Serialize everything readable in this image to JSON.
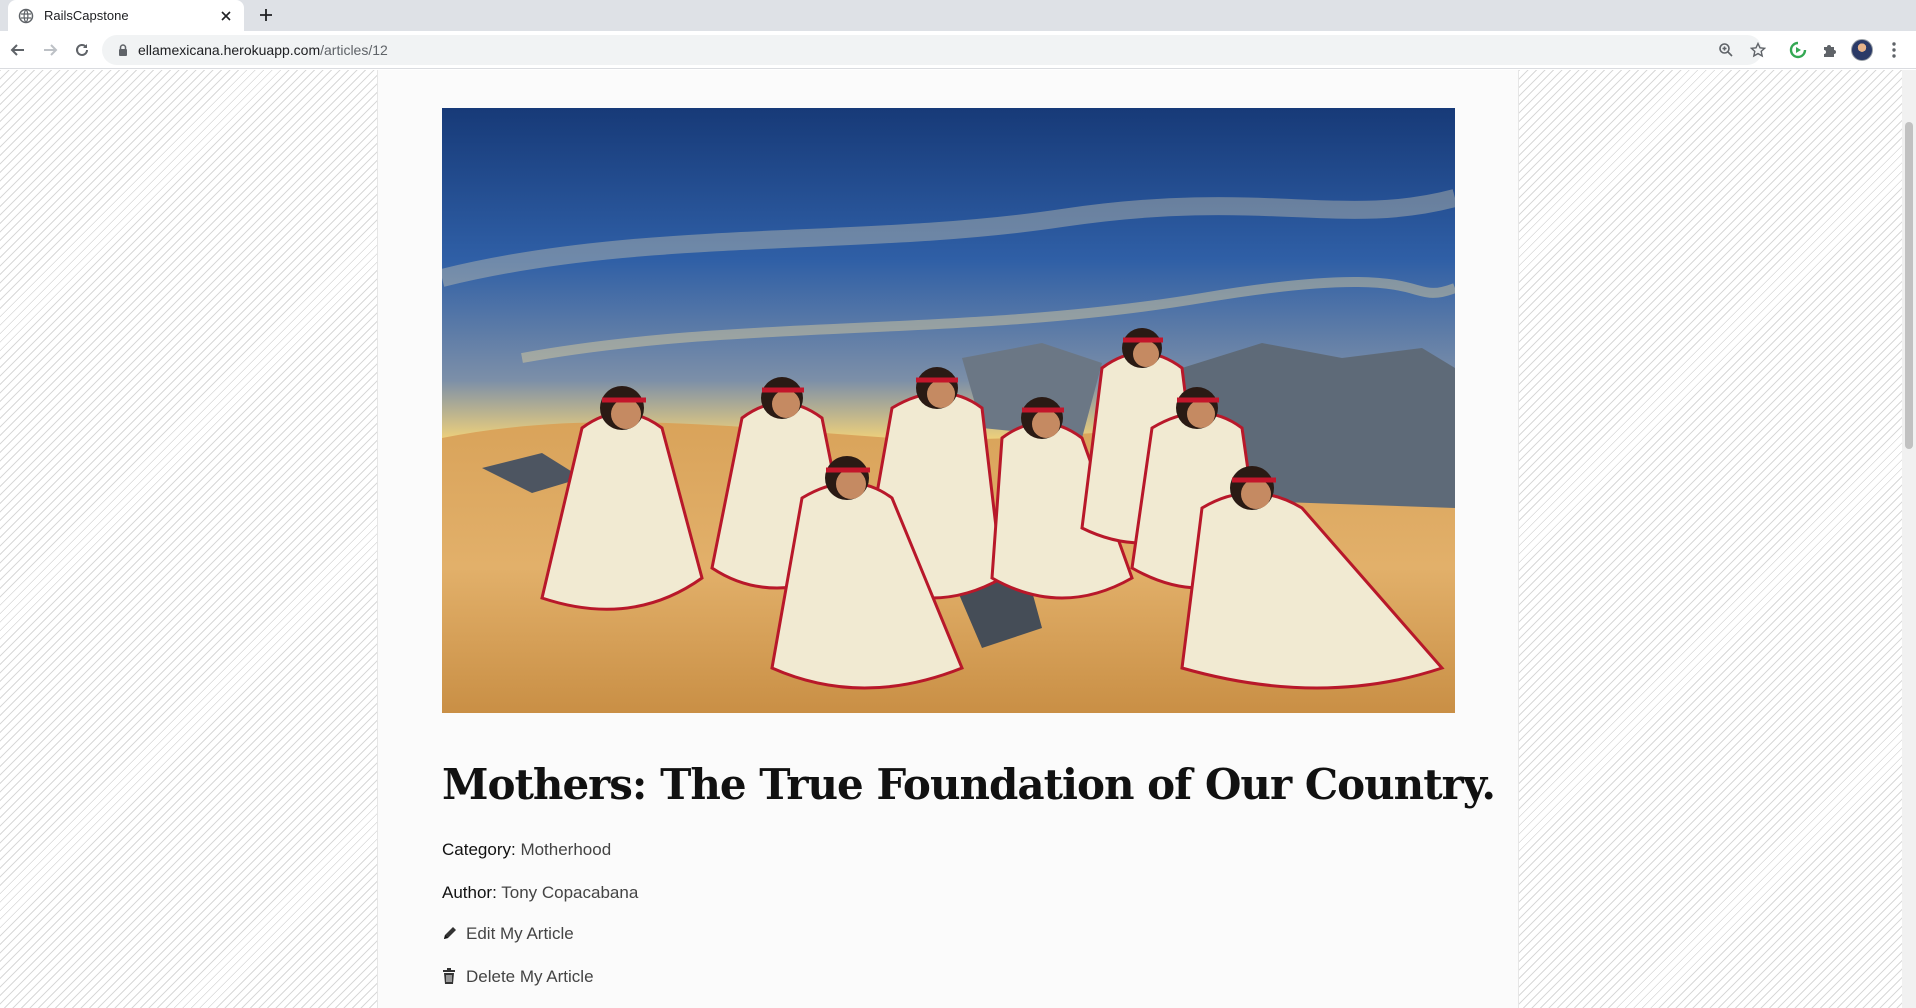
{
  "browser": {
    "tab_title": "RailsCapstone",
    "url_host": "ellamexicana.herokuapp.com",
    "url_path": "/articles/12"
  },
  "article": {
    "image_alt": "Women in white dresses with red trim and headbands sitting in the desert",
    "title": "Mothers: The True Foundation of Our Country.",
    "category_label": "Category:",
    "category_value": "Motherhood",
    "author_label": "Author:",
    "author_value": "Tony Copacabana",
    "edit_label": "Edit My Article",
    "delete_label": "Delete My Article"
  },
  "icons": {
    "favicon": "globe-icon",
    "close": "close-icon",
    "new_tab": "plus-icon",
    "back": "arrow-left-icon",
    "forward": "arrow-right-icon",
    "reload": "reload-icon",
    "lock": "lock-icon",
    "zoom": "zoom-icon",
    "bookmark": "star-icon",
    "extension_green": "extension-icon",
    "extensions": "puzzle-icon",
    "menu": "kebab-menu-icon",
    "edit": "pencil-icon",
    "delete": "trash-icon"
  },
  "colors": {
    "chrome_bg": "#dee1e6",
    "page_card": "#fbfbfb",
    "title_text": "#111111"
  }
}
